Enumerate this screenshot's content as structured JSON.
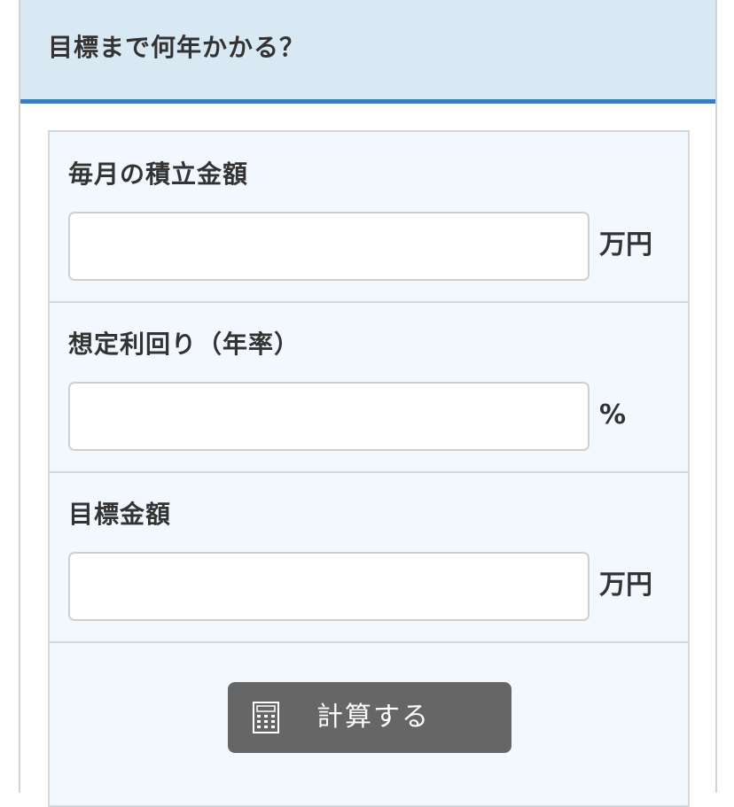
{
  "header": {
    "title": "目標まで何年かかる？"
  },
  "form": {
    "fields": [
      {
        "label": "毎月の積立金額",
        "value": "",
        "placeholder": "",
        "unit": "万円"
      },
      {
        "label": "想定利回り（年率）",
        "value": "",
        "placeholder": "",
        "unit": "%"
      },
      {
        "label": "目標金額",
        "value": "",
        "placeholder": "",
        "unit": "万円"
      }
    ],
    "calculate_button": {
      "label": "計算する",
      "icon": "calculator-icon"
    }
  },
  "colors": {
    "header_bg": "#d9e9f4",
    "header_accent": "#3a7fbb",
    "form_bg": "#f2f8fd",
    "button_bg": "#666666"
  }
}
